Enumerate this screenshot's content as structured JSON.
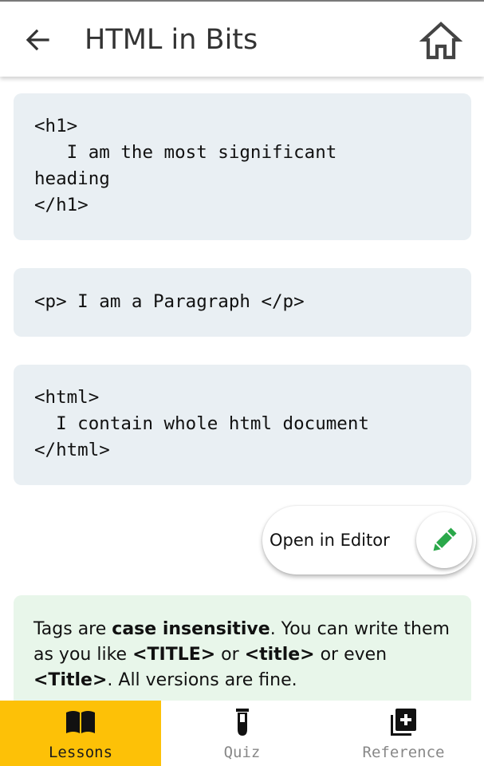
{
  "app": {
    "title": "HTML in Bits"
  },
  "header": {
    "back_icon": "arrow-back-icon",
    "home_icon": "home-icon"
  },
  "code_blocks": [
    {
      "code": "<h1>\n   I am the most significant\nheading\n</h1>"
    },
    {
      "code": "<p> I am a Paragraph </p>"
    },
    {
      "code": "<html>\n  I contain whole html document\n</html>"
    }
  ],
  "editor_button": {
    "label": "Open in Editor",
    "icon": "pencil-icon",
    "icon_color": "#2aa84a"
  },
  "tip": {
    "t1": "Tags are ",
    "b1": "case insensitive",
    "t2": ". You can write them as you like ",
    "b2": "<TITLE>",
    "t3": " or ",
    "b3": "<title>",
    "t4": " or even ",
    "b4": "<Title>",
    "t5": ". All versions are fine."
  },
  "bottom_nav": {
    "items": [
      {
        "label": "Lessons",
        "icon": "book-icon",
        "active": true
      },
      {
        "label": "Quiz",
        "icon": "test-tube-icon",
        "active": false
      },
      {
        "label": "Reference",
        "icon": "library-add-icon",
        "active": false
      }
    ]
  },
  "colors": {
    "active_tab": "#fdc107",
    "code_background": "#e9eff3",
    "tip_background": "#e8f6ea",
    "pencil": "#2aa84a"
  }
}
